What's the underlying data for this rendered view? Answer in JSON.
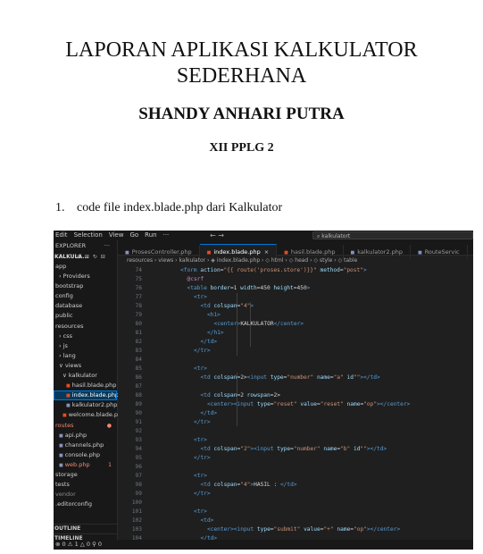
{
  "document": {
    "title_line1": "LAPORAN APLIKASI KALKULATOR",
    "title_line2": "SEDERHANA",
    "author": "SHANDY ANHARI PUTRA",
    "class": "XII PPLG 2",
    "list_number": "1.",
    "list_text": "code file index.blade.php dari Kalkulator"
  },
  "screenshot": {
    "menu": [
      "Edit",
      "Selection",
      "View",
      "Go",
      "Run",
      "···"
    ],
    "nav_arrows": "←  →",
    "search_text": "⌕ kalkulatort",
    "explorer_title": "EXPLORER",
    "explorer_more": "···",
    "project_name": "KALKULA...",
    "project_actions": "⊕ ⊞ ↻ ⊟",
    "tree": [
      {
        "label": "app",
        "indent": 2,
        "color": "#cfcfcf"
      },
      {
        "label": "› Providers",
        "indent": 6,
        "color": "#cfcfcf"
      },
      {
        "label": "bootstrap",
        "indent": 2,
        "color": "#cfcfcf"
      },
      {
        "label": "config",
        "indent": 2,
        "color": "#cfcfcf"
      },
      {
        "label": "database",
        "indent": 2,
        "color": "#cfcfcf"
      },
      {
        "label": "public",
        "indent": 2,
        "color": "#cfcfcf"
      },
      {
        "label": "resources",
        "indent": 2,
        "color": "#cfcfcf"
      },
      {
        "label": "› css",
        "indent": 6,
        "color": "#cfcfcf"
      },
      {
        "label": "› js",
        "indent": 6,
        "color": "#cfcfcf"
      },
      {
        "label": "› lang",
        "indent": 6,
        "color": "#cfcfcf"
      },
      {
        "label": "∨ views",
        "indent": 6,
        "color": "#cfcfcf"
      },
      {
        "label": "∨ kalkulator",
        "indent": 10,
        "color": "#cfcfcf"
      },
      {
        "label": "hasil.blade.php",
        "indent": 14,
        "color": "#cfcfcf",
        "icon": "blade"
      },
      {
        "label": "index.blade.php",
        "indent": 14,
        "color": "#ffffff",
        "icon": "blade",
        "selected": true
      },
      {
        "label": "kalkulator2.php",
        "indent": 14,
        "color": "#cfcfcf",
        "icon": "php"
      },
      {
        "label": "welcome.blade.php",
        "indent": 10,
        "color": "#cfcfcf",
        "icon": "blade"
      },
      {
        "label": "routes",
        "indent": 2,
        "color": "#f48771",
        "dot": "●"
      },
      {
        "label": "api.php",
        "indent": 6,
        "color": "#cfcfcf",
        "icon": "php"
      },
      {
        "label": "channels.php",
        "indent": 6,
        "color": "#cfcfcf",
        "icon": "php"
      },
      {
        "label": "console.php",
        "indent": 6,
        "color": "#cfcfcf",
        "icon": "php"
      },
      {
        "label": "web.php",
        "indent": 6,
        "color": "#f48771",
        "icon": "php",
        "badge": "1"
      },
      {
        "label": "storage",
        "indent": 2,
        "color": "#cfcfcf"
      },
      {
        "label": "tests",
        "indent": 2,
        "color": "#cfcfcf"
      },
      {
        "label": "vendor",
        "indent": 2,
        "color": "#8b8b8b"
      },
      {
        "label": ".editorconfig",
        "indent": 2,
        "color": "#cfcfcf"
      }
    ],
    "outline_label": "OUTLINE",
    "timeline_label": "TIMELINE",
    "status": "⊗ 0 ⚠ 1 △ 0   ⚲ 0",
    "tabs": [
      {
        "label": "ProsesController.php",
        "active": false,
        "icon_color": "#8892bf"
      },
      {
        "label": "index.blade.php",
        "active": true,
        "icon_color": "#e44d26",
        "close": "×"
      },
      {
        "label": "hasil.blade.php",
        "active": false,
        "icon_color": "#e44d26"
      },
      {
        "label": "kalkulator2.php",
        "active": false,
        "icon_color": "#8892bf"
      },
      {
        "label": "RouteServic",
        "active": false,
        "icon_color": "#8892bf"
      }
    ],
    "breadcrumbs": "resources › views › kalkulator › ◈ index.blade.php › ◇ html › ◇ head › ◇ style › ◇ table",
    "code_lines": [
      {
        "n": "74",
        "indent": 4,
        "seg": [
          [
            "tg",
            "<form "
          ],
          [
            "at",
            "action"
          ],
          [
            "pl",
            "="
          ],
          [
            "vl",
            "\"{{ route('proses.store')}}\""
          ],
          [
            "pl",
            " "
          ],
          [
            "at",
            "method"
          ],
          [
            "pl",
            "="
          ],
          [
            "vl",
            "\"post\""
          ],
          [
            "tg",
            ">"
          ]
        ]
      },
      {
        "n": "75",
        "indent": 5,
        "seg": [
          [
            "bl",
            "@csrf"
          ]
        ]
      },
      {
        "n": "76",
        "indent": 5,
        "seg": [
          [
            "tg",
            "<table "
          ],
          [
            "at",
            "border"
          ],
          [
            "pl",
            "=1 "
          ],
          [
            "at",
            "width"
          ],
          [
            "pl",
            "=450 "
          ],
          [
            "at",
            "height"
          ],
          [
            "pl",
            "=450"
          ],
          [
            "tg",
            ">"
          ]
        ]
      },
      {
        "n": "77",
        "indent": 6,
        "seg": [
          [
            "tg",
            "<tr>"
          ]
        ]
      },
      {
        "n": "78",
        "indent": 7,
        "seg": [
          [
            "tg",
            "<td "
          ],
          [
            "at",
            "colspan"
          ],
          [
            "pl",
            "="
          ],
          [
            "vl",
            "\"4\""
          ],
          [
            "tg",
            ">"
          ]
        ]
      },
      {
        "n": "79",
        "indent": 8,
        "seg": [
          [
            "tg",
            "<h1>"
          ]
        ]
      },
      {
        "n": "80",
        "indent": 9,
        "seg": [
          [
            "tg",
            "<center>"
          ],
          [
            "pl",
            "KALKULATOR"
          ],
          [
            "tg",
            "</center>"
          ]
        ]
      },
      {
        "n": "81",
        "indent": 8,
        "seg": [
          [
            "tg",
            "</h1>"
          ]
        ]
      },
      {
        "n": "82",
        "indent": 7,
        "seg": [
          [
            "tg",
            "</td>"
          ]
        ]
      },
      {
        "n": "83",
        "indent": 6,
        "seg": [
          [
            "tg",
            "</tr>"
          ]
        ]
      },
      {
        "n": "84",
        "indent": 0,
        "seg": []
      },
      {
        "n": "85",
        "indent": 6,
        "seg": [
          [
            "tg",
            "<tr>"
          ]
        ]
      },
      {
        "n": "86",
        "indent": 7,
        "seg": [
          [
            "tg",
            "<td "
          ],
          [
            "at",
            "colspan"
          ],
          [
            "pl",
            "=2>"
          ],
          [
            "tg",
            "<input "
          ],
          [
            "at",
            "type"
          ],
          [
            "pl",
            "="
          ],
          [
            "vl",
            "\"number\""
          ],
          [
            "pl",
            " "
          ],
          [
            "at",
            "name"
          ],
          [
            "pl",
            "="
          ],
          [
            "vl",
            "\"a\""
          ],
          [
            "pl",
            " "
          ],
          [
            "at",
            "id"
          ],
          [
            "vl",
            "\"\""
          ],
          [
            "tg",
            "></td>"
          ]
        ]
      },
      {
        "n": "87",
        "indent": 0,
        "seg": []
      },
      {
        "n": "88",
        "indent": 7,
        "seg": [
          [
            "tg",
            "<td "
          ],
          [
            "at",
            "colspan"
          ],
          [
            "pl",
            "=2 "
          ],
          [
            "at",
            "rowspan"
          ],
          [
            "pl",
            "=2>"
          ]
        ]
      },
      {
        "n": "89",
        "indent": 8,
        "seg": [
          [
            "tg",
            "<center><input "
          ],
          [
            "at",
            "type"
          ],
          [
            "pl",
            "="
          ],
          [
            "vl",
            "\"reset\""
          ],
          [
            "pl",
            " "
          ],
          [
            "at",
            "value"
          ],
          [
            "pl",
            "="
          ],
          [
            "vl",
            "\"reset\""
          ],
          [
            "pl",
            " "
          ],
          [
            "at",
            "name"
          ],
          [
            "pl",
            "="
          ],
          [
            "vl",
            "\"op\""
          ],
          [
            "tg",
            "></center>"
          ]
        ]
      },
      {
        "n": "90",
        "indent": 7,
        "seg": [
          [
            "tg",
            "</td>"
          ]
        ]
      },
      {
        "n": "91",
        "indent": 6,
        "seg": [
          [
            "tg",
            "</tr>"
          ]
        ]
      },
      {
        "n": "92",
        "indent": 0,
        "seg": []
      },
      {
        "n": "93",
        "indent": 6,
        "seg": [
          [
            "tg",
            "<tr>"
          ]
        ]
      },
      {
        "n": "94",
        "indent": 7,
        "seg": [
          [
            "tg",
            "<td "
          ],
          [
            "at",
            "colspan"
          ],
          [
            "pl",
            "="
          ],
          [
            "vl",
            "\"2\""
          ],
          [
            "tg",
            "><input "
          ],
          [
            "at",
            "type"
          ],
          [
            "pl",
            "="
          ],
          [
            "vl",
            "\"number\""
          ],
          [
            "pl",
            " "
          ],
          [
            "at",
            "name"
          ],
          [
            "pl",
            "="
          ],
          [
            "vl",
            "\"b\""
          ],
          [
            "pl",
            " "
          ],
          [
            "at",
            "id"
          ],
          [
            "vl",
            "\"\""
          ],
          [
            "tg",
            "></td>"
          ]
        ]
      },
      {
        "n": "95",
        "indent": 6,
        "seg": [
          [
            "tg",
            "</tr>"
          ]
        ]
      },
      {
        "n": "96",
        "indent": 0,
        "seg": []
      },
      {
        "n": "97",
        "indent": 6,
        "seg": [
          [
            "tg",
            "<tr>"
          ]
        ]
      },
      {
        "n": "98",
        "indent": 7,
        "seg": [
          [
            "tg",
            "<td "
          ],
          [
            "at",
            "colspan"
          ],
          [
            "pl",
            "="
          ],
          [
            "vl",
            "\"4\""
          ],
          [
            "tg",
            ">"
          ],
          [
            "pl",
            "HASIL : "
          ],
          [
            "tg",
            "</td>"
          ]
        ]
      },
      {
        "n": "99",
        "indent": 6,
        "seg": [
          [
            "tg",
            "</tr>"
          ]
        ]
      },
      {
        "n": "100",
        "indent": 0,
        "seg": []
      },
      {
        "n": "101",
        "indent": 6,
        "seg": [
          [
            "tg",
            "<tr>"
          ]
        ]
      },
      {
        "n": "102",
        "indent": 7,
        "seg": [
          [
            "tg",
            "<td>"
          ]
        ]
      },
      {
        "n": "103",
        "indent": 8,
        "seg": [
          [
            "tg",
            "<center><input "
          ],
          [
            "at",
            "type"
          ],
          [
            "pl",
            "="
          ],
          [
            "vl",
            "\"submit\""
          ],
          [
            "pl",
            " "
          ],
          [
            "at",
            "value"
          ],
          [
            "pl",
            "="
          ],
          [
            "vl",
            "\"+\""
          ],
          [
            "pl",
            " "
          ],
          [
            "at",
            "name"
          ],
          [
            "pl",
            "="
          ],
          [
            "vl",
            "\"op\""
          ],
          [
            "tg",
            "></center>"
          ]
        ]
      },
      {
        "n": "104",
        "indent": 7,
        "seg": [
          [
            "tg",
            "</td>"
          ]
        ]
      },
      {
        "n": "105",
        "indent": 0,
        "seg": []
      }
    ]
  }
}
